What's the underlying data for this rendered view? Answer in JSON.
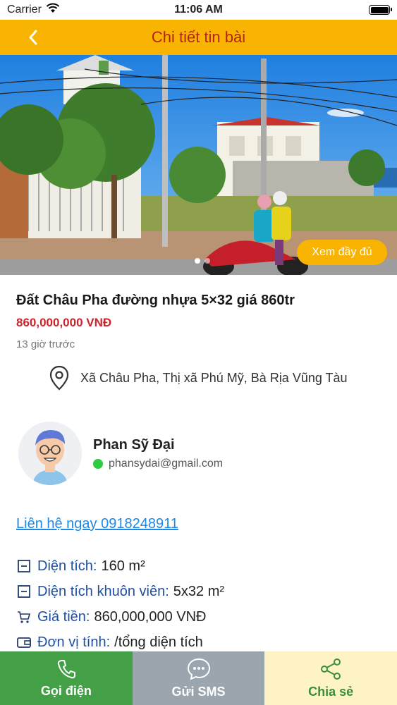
{
  "status_bar": {
    "carrier": "Carrier",
    "time": "11:06 AM"
  },
  "header": {
    "title": "Chi tiết tin bài"
  },
  "hero": {
    "view_full_label": "Xem đầy đủ",
    "image_count": 2,
    "active_index": 0
  },
  "listing": {
    "title": "Đất Châu Pha đường nhựa 5×32 giá 860tr",
    "price": "860,000,000 VNĐ",
    "time_ago": "13 giờ trước",
    "address": "Xã Châu Pha, Thị xã  Phú Mỹ, Bà Rịa Vũng Tàu"
  },
  "seller": {
    "name": "Phan Sỹ Đại",
    "email": "phansydai@gmail.com"
  },
  "contact": {
    "link_text": "Liên hệ ngay 0918248911"
  },
  "specs": [
    {
      "icon": "minus-box-icon",
      "label": "Diện tích:",
      "value": "160 m²"
    },
    {
      "icon": "minus-box-icon",
      "label": "Diện tích khuôn viên:",
      "value": "5x32 m²"
    },
    {
      "icon": "cart-icon",
      "label": "Giá tiền:",
      "value": "860,000,000 VNĐ"
    },
    {
      "icon": "wallet-icon",
      "label": "Đơn vị tính:",
      "value": "/tổng diện tích"
    }
  ],
  "bottom_bar": {
    "call_label": "Gọi điện",
    "sms_label": "Gửi SMS",
    "share_label": "Chia sẻ"
  },
  "colors": {
    "accent": "#f8b400",
    "title_red": "#b3261e",
    "price_red": "#d0222b",
    "link_blue": "#1e88e5",
    "spec_blue": "#1f4fa0",
    "call_green": "#43a047",
    "sms_gray": "#9aa5ae",
    "share_bg": "#fdf3c4"
  }
}
